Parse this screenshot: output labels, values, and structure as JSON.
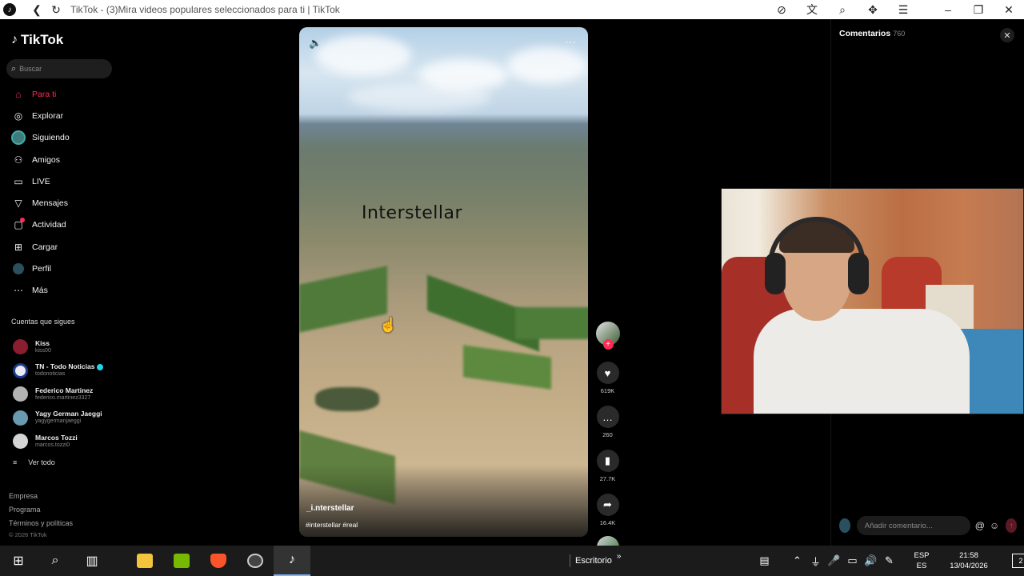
{
  "browser": {
    "title": "TikTok - (3)Mira videos populares seleccionados para ti | TikTok"
  },
  "sidebar": {
    "logo": "TikTok",
    "search_placeholder": "Buscar",
    "nav": [
      {
        "label": "Para ti",
        "icon": "home-icon",
        "active": true
      },
      {
        "label": "Explorar",
        "icon": "compass-icon"
      },
      {
        "label": "Siguiendo",
        "icon": "following-avatar-icon"
      },
      {
        "label": "Amigos",
        "icon": "friends-icon"
      },
      {
        "label": "LIVE",
        "icon": "live-tv-icon"
      },
      {
        "label": "Mensajes",
        "icon": "send-icon"
      },
      {
        "label": "Actividad",
        "icon": "activity-icon"
      },
      {
        "label": "Cargar",
        "icon": "upload-icon"
      },
      {
        "label": "Perfil",
        "icon": "profile-icon"
      },
      {
        "label": "Más",
        "icon": "more-icon"
      }
    ],
    "following_title": "Cuentas que sigues",
    "following": [
      {
        "name": "Kiss",
        "handle": "kiss00",
        "verified": false,
        "color": "#8a1e2e"
      },
      {
        "name": "TN - Todo Noticias",
        "handle": "todonoticias",
        "verified": true,
        "color": "#e8e8f5"
      },
      {
        "name": "Federico Martinez",
        "handle": "federico.martinez3327",
        "verified": false,
        "color": "#b3b3b3"
      },
      {
        "name": "Yagy German Jaeggi",
        "handle": "yagygermanjaeggi",
        "verified": false,
        "color": "#6a9ab0"
      },
      {
        "name": "Marcos Tozzi",
        "handle": "marcos.tozzi0",
        "verified": false,
        "color": "#d5d5d5"
      }
    ],
    "see_all": "Ver todo",
    "footer": [
      "Empresa",
      "Programa",
      "Términos y políticas"
    ],
    "copyright": "© 2026 TikTok"
  },
  "video": {
    "overlay_text": "Interstellar",
    "author": "_i.nterstellar",
    "tags": "#interstellar #real"
  },
  "actions": {
    "likes": "619K",
    "comments": "260",
    "saves": "27.7K",
    "shares": "16.4K"
  },
  "comments_panel": {
    "title": "Comentarios",
    "count": "760",
    "placeholder": "Añadir comentario..."
  },
  "taskbar": {
    "desktop": "Escritorio",
    "lang1": "ESP",
    "lang2": "ES",
    "time": "21:58",
    "date": "13/04/2026",
    "notifications": "2"
  },
  "colors": {
    "accent": "#fe2c55",
    "background": "#000000"
  }
}
